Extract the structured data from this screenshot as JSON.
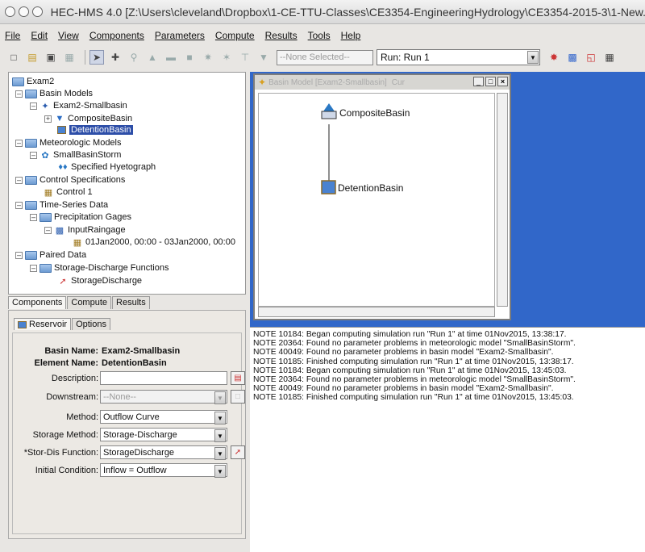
{
  "window": {
    "title": "HEC-HMS 4.0 [Z:\\Users\\cleveland\\Dropbox\\1-CE-TTU-Classes\\CE3354-EngineeringHydrology\\CE3354-2015-3\\1-New..."
  },
  "menu": [
    "File",
    "Edit",
    "View",
    "Components",
    "Parameters",
    "Compute",
    "Results",
    "Tools",
    "Help"
  ],
  "toolbar": {
    "none_selected": "--None Selected--",
    "run_select": "Run: Run 1"
  },
  "tree": {
    "root": "Exam2",
    "basin_models": "Basin Models",
    "basin": "Exam2-Smallbasin",
    "composite": "CompositeBasin",
    "detention": "DetentionBasin",
    "met_models": "Meteorologic Models",
    "met": "SmallBasinStorm",
    "hyeto": "Specified Hyetograph",
    "control_specs": "Control Specifications",
    "control": "Control 1",
    "ts_data": "Time-Series Data",
    "precip_gages": "Precipitation Gages",
    "raingage": "InputRaingage",
    "range": "01Jan2000, 00:00 - 03Jan2000, 00:00",
    "paired": "Paired Data",
    "sd_functions": "Storage-Discharge Functions",
    "sd": "StorageDischarge"
  },
  "tabs": [
    "Components",
    "Compute",
    "Results"
  ],
  "editor": {
    "tabs": [
      "Reservoir",
      "Options"
    ],
    "basin_name_label": "Basin Name:",
    "basin_name": "Exam2-Smallbasin",
    "element_name_label": "Element Name:",
    "element_name": "DetentionBasin",
    "description_label": "Description:",
    "description": "",
    "downstream_label": "Downstream:",
    "downstream": "--None--",
    "method_label": "Method:",
    "method": "Outflow Curve",
    "storage_method_label": "Storage Method:",
    "storage_method": "Storage-Discharge",
    "stor_dis_label": "*Stor-Dis Function:",
    "stor_dis": "StorageDischarge",
    "initial_label": "Initial Condition:",
    "initial": "Inflow = Outflow"
  },
  "basin_window": {
    "title": "Basin Model [Exam2-Smallbasin]",
    "title_suffix": "Cur",
    "composite": "CompositeBasin",
    "detention": "DetentionBasin"
  },
  "log": [
    "NOTE 10184: Began computing simulation run \"Run 1\" at time 01Nov2015, 13:38:17.",
    "NOTE 20364: Found no parameter problems in meteorologic model \"SmallBasinStorm\".",
    "NOTE 40049: Found no parameter problems in basin model \"Exam2-Smallbasin\".",
    "NOTE 10185: Finished computing simulation run \"Run 1\" at time 01Nov2015, 13:38:17.",
    "NOTE 10184: Began computing simulation run \"Run 1\" at time 01Nov2015, 13:45:03.",
    "NOTE 20364: Found no parameter problems in meteorologic model \"SmallBasinStorm\".",
    "NOTE 40049: Found no parameter problems in basin model \"Exam2-Smallbasin\".",
    "NOTE 10185: Finished computing simulation run \"Run 1\" at time 01Nov2015, 13:45:03."
  ],
  "colors": {
    "accent_blue": "#3167c9",
    "selection": "#2d4ea8",
    "required_star": "#cc0000"
  }
}
